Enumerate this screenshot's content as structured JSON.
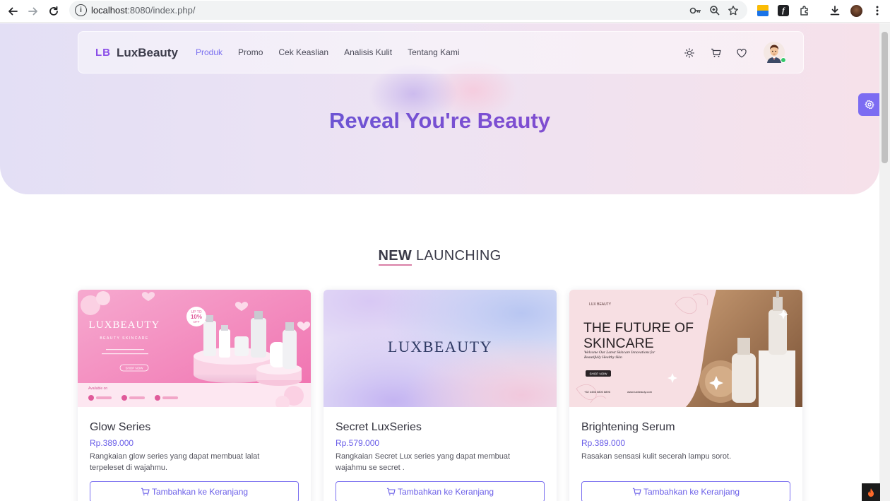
{
  "browser": {
    "url_host": "localhost",
    "url_rest": ":8080/index.php/"
  },
  "navbar": {
    "logo_mark": "LB",
    "logo_text": "LuxBeauty",
    "menu": [
      {
        "label": "Produk",
        "active": true
      },
      {
        "label": "Promo",
        "active": false
      },
      {
        "label": "Cek Keaslian",
        "active": false
      },
      {
        "label": "Analisis Kulit",
        "active": false
      },
      {
        "label": "Tentang Kami",
        "active": false
      }
    ],
    "icons": [
      "sun-icon",
      "cart-icon",
      "heart-icon"
    ]
  },
  "hero": {
    "title": "Reveal You're Beauty"
  },
  "section": {
    "title_strong": "NEW",
    "title_rest": " LAUNCHING"
  },
  "products": [
    {
      "name": "Glow Series",
      "price": "Rp.389.000",
      "desc": "Rangkaian glow series yang dapat membuat lalat terpeleset di wajahmu.",
      "button": "Tambahkan ke Keranjang",
      "banner": {
        "brand": "LUXBEAUTY",
        "sub": "BEAUTY SKINCARE",
        "badge_top": "UP TO",
        "badge_value": "10%",
        "badge_bottom": "OFF",
        "cta": "SHOP NOW",
        "available": "Available on"
      }
    },
    {
      "name": "Secret LuxSeries",
      "price": "Rp.579.000",
      "desc": "Rangkaian Secret Lux series yang dapat membuat wajahmu se secret .",
      "button": "Tambahkan ke Keranjang",
      "banner": {
        "brand": "LUXBEAUTY"
      }
    },
    {
      "name": "Brightening Serum",
      "price": "Rp.389.000",
      "desc": "Rasakan sensasi kulit secerah lampu sorot.",
      "button": "Tambahkan ke Keranjang",
      "banner": {
        "small_brand": "LUX BEAUTY",
        "headline_1": "THE FUTURE OF",
        "headline_2": "SKINCARE",
        "tagline_1": "Welcome Our Latest Skincare Innovations for",
        "tagline_2": "Beautifully Healthy Skin",
        "cta": "SHOP NOW",
        "phone": "+62 4456 0800 6896",
        "web": "www.luxbeauty.com"
      }
    }
  ],
  "colors": {
    "accent": "#7a6ff0",
    "logo": "#8a4ee8",
    "title_gradient_start": "#4f5fd6",
    "title_gradient_end": "#9448c6"
  }
}
